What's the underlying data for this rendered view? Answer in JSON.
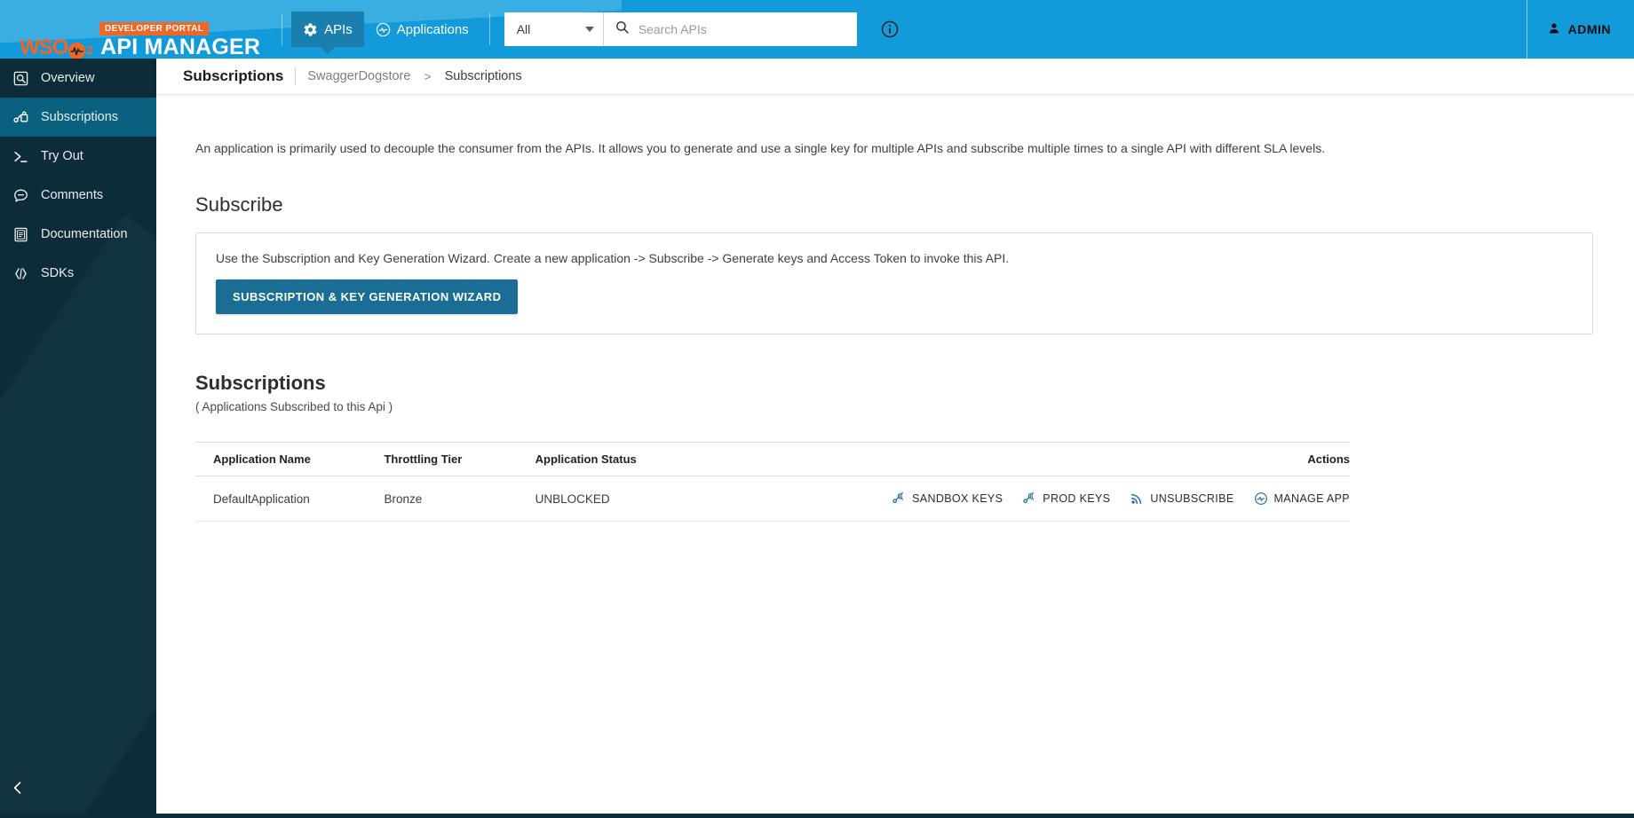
{
  "header": {
    "brand_mark": "WSO",
    "brand_sub": "2",
    "brand_title": "API MANAGER",
    "dev_portal_badge": "DEVELOPER PORTAL",
    "tabs": [
      {
        "label": "APIs",
        "icon": "gear-icon",
        "active": true
      },
      {
        "label": "Applications",
        "icon": "applications-icon",
        "active": false
      }
    ],
    "search": {
      "filter_value": "All",
      "placeholder": "Search APIs",
      "value": ""
    },
    "info_icon": "info-circle-icon",
    "user": {
      "label": "ADMIN",
      "icon": "person-icon"
    }
  },
  "sidebar": {
    "items": [
      {
        "label": "Overview",
        "icon": "overview-magnifier-icon",
        "active": false
      },
      {
        "label": "Subscriptions",
        "icon": "subscriptions-key-icon",
        "active": true
      },
      {
        "label": "Try Out",
        "icon": "terminal-prompt-icon",
        "active": false
      },
      {
        "label": "Comments",
        "icon": "comment-bubble-icon",
        "active": false
      },
      {
        "label": "Documentation",
        "icon": "document-icon",
        "active": false
      },
      {
        "label": "SDKs",
        "icon": "code-brackets-icon",
        "active": false
      }
    ],
    "collapse_icon": "chevron-left-icon"
  },
  "breadcrumb": {
    "page_title": "Subscriptions",
    "api_name": "SwaggerDogstore",
    "separator": ">",
    "current": "Subscriptions"
  },
  "main": {
    "lead_text": "An application is primarily used to decouple the consumer from the APIs. It allows you to generate and use a single key for multiple APIs and subscribe multiple times to a single API with different SLA levels.",
    "subscribe": {
      "heading": "Subscribe",
      "wizard_text": "Use the Subscription and Key Generation Wizard. Create a new application -> Subscribe -> Generate keys and Access Token to invoke this API.",
      "wizard_button": "SUBSCRIPTION & KEY GENERATION WIZARD"
    },
    "subscriptions": {
      "heading": "Subscriptions",
      "subheading": "( Applications Subscribed to this Api )",
      "columns": [
        "Application Name",
        "Throttling Tier",
        "Application Status",
        "Actions"
      ],
      "rows": [
        {
          "application_name": "DefaultApplication",
          "throttling_tier": "Bronze",
          "application_status": "UNBLOCKED",
          "actions": [
            {
              "label": "SANDBOX KEYS",
              "icon": "key-sandbox-icon"
            },
            {
              "label": "PROD KEYS",
              "icon": "key-prod-icon"
            },
            {
              "label": "UNSUBSCRIBE",
              "icon": "rss-unsubscribe-icon"
            },
            {
              "label": "MANAGE APP",
              "icon": "manage-app-icon"
            }
          ]
        }
      ]
    }
  },
  "colors": {
    "header_blue": "#139ada",
    "header_blue_light": "#3aaee3",
    "tab_active": "#1b7fae",
    "sidebar_dark": "#0d2b38",
    "sidebar_active": "#09607f",
    "brand_orange": "#f26522",
    "action_link": "#1a6d94",
    "primary_button": "#1a6d94"
  }
}
